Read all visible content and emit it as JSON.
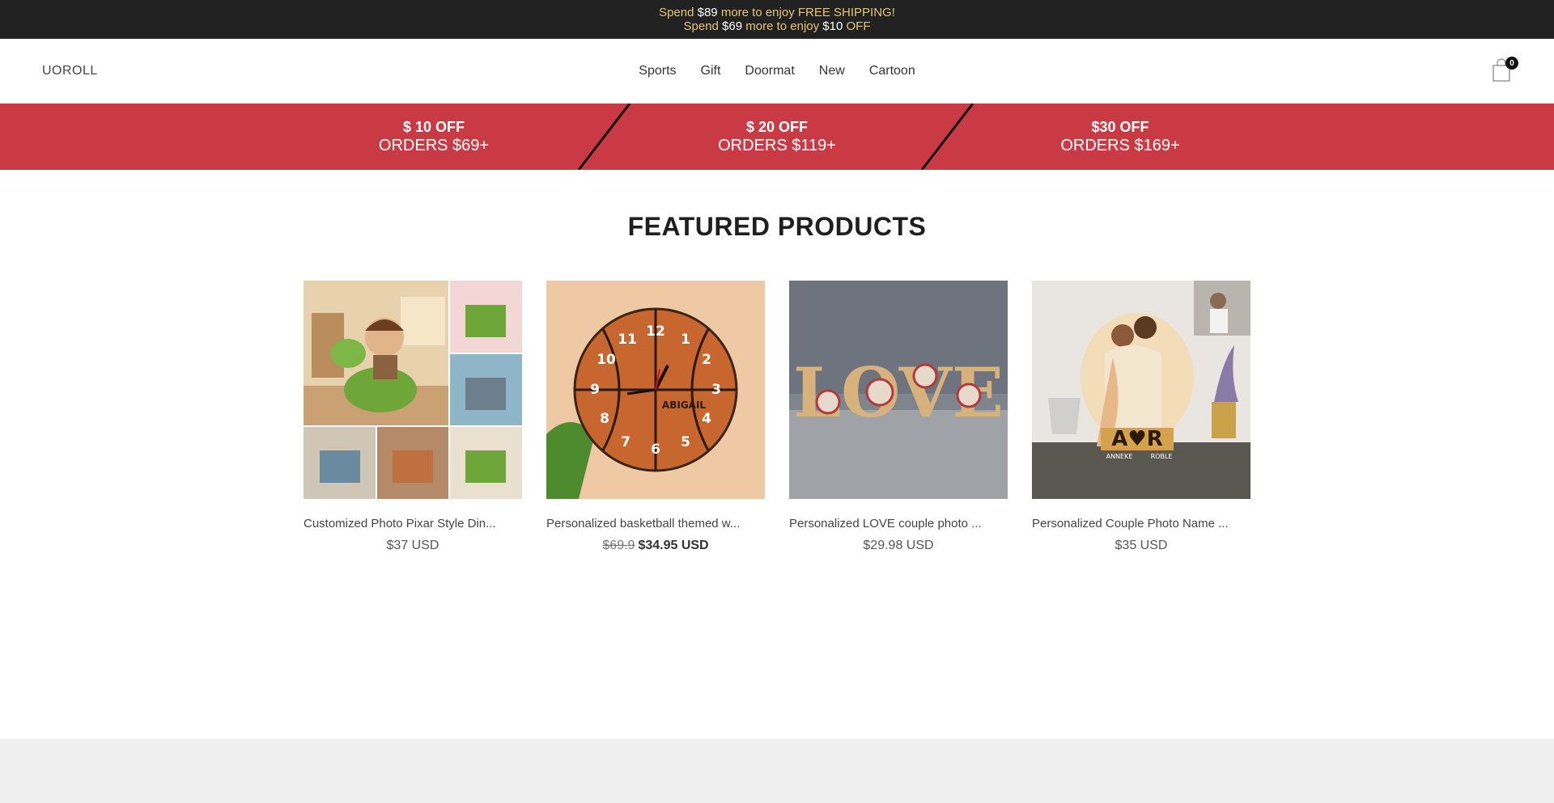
{
  "announcement": {
    "line1": {
      "prefix": "Spend ",
      "amount": "$89",
      "suffix": " more to enjoy FREE SHIPPING!"
    },
    "line2": {
      "prefix": "Spend ",
      "amount": "$69",
      "middle": " more to enjoy ",
      "discount": "$10",
      "suffix": " OFF"
    }
  },
  "header": {
    "logo": "UOROLL",
    "nav": [
      "Sports",
      "Gift",
      "Doormat",
      "New",
      "Cartoon"
    ],
    "cart_count": "0"
  },
  "promo": [
    {
      "top": "$ 10 OFF",
      "bottom": "ORDERS $69+"
    },
    {
      "top": "$ 20 OFF",
      "bottom": "ORDERS $119+"
    },
    {
      "top": "$30 OFF",
      "bottom": "ORDERS $169+"
    }
  ],
  "featured": {
    "title": "FEATURED PRODUCTS",
    "products": [
      {
        "title": "Customized Photo Pixar Style Din...",
        "price": "$37 USD",
        "old_price": "",
        "image_icon": "dinosaur-collage-image"
      },
      {
        "title": "Personalized basketball themed w...",
        "price": "$34.95 USD",
        "old_price": "$69.9",
        "image_icon": "basketball-clock-image",
        "clock_name": "ABIGAIL"
      },
      {
        "title": "Personalized LOVE couple photo ...",
        "price": "$29.98 USD",
        "old_price": "",
        "image_icon": "love-frame-image"
      },
      {
        "title": "Personalized Couple Photo Name ...",
        "price": "$35 USD",
        "old_price": "",
        "image_icon": "couple-lamp-image",
        "lamp_left": "ANNEKE",
        "lamp_right": "ROBLE"
      }
    ]
  },
  "colors": {
    "announcement_bg": "#212121",
    "announcement_text": "#e8c47a",
    "promo_bg": "#c93a45",
    "footer_bg": "#efefef"
  }
}
